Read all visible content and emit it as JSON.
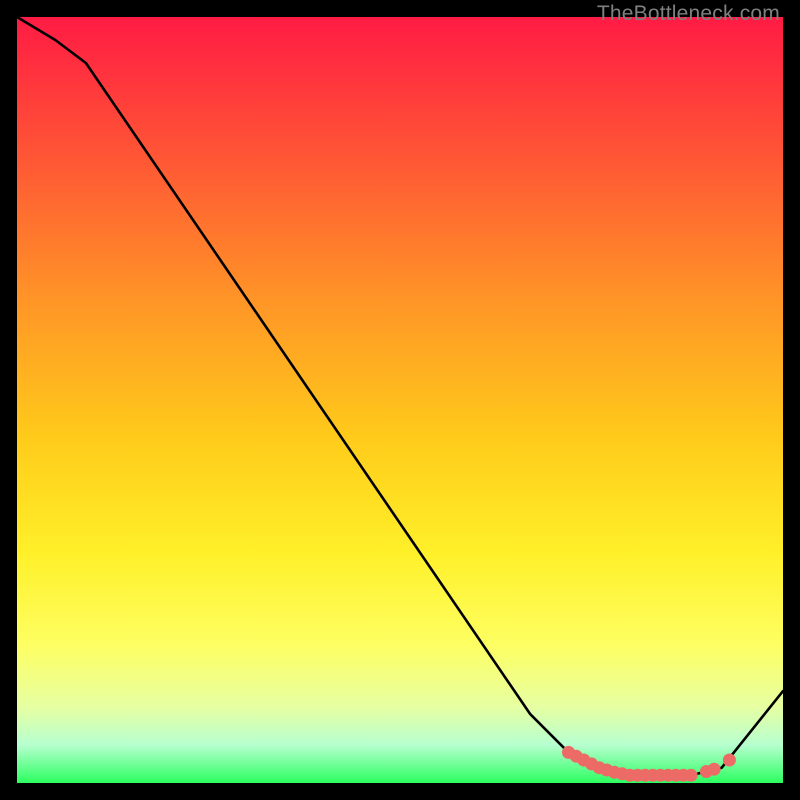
{
  "attribution": "TheBottleneck.com",
  "colors": {
    "black": "#000000",
    "grey": "#7f7f7f",
    "line": "#000000",
    "marker": "#ec6b66",
    "grad_top": "#ff1b44",
    "grad_1": "#ff5535",
    "grad_2": "#ff9826",
    "grad_3": "#ffcb1a",
    "grad_4": "#fff029",
    "grad_5": "#fdff62",
    "grad_6": "#e7ffa2",
    "grad_7": "#b7ffcf",
    "grad_bottom": "#2bff60"
  },
  "chart_data": {
    "type": "line",
    "title": "",
    "xlabel": "",
    "ylabel": "",
    "xlim": [
      0,
      100
    ],
    "ylim": [
      0,
      100
    ],
    "series": [
      {
        "name": "curve",
        "x": [
          0,
          5,
          9,
          67,
          72,
          76,
          80,
          84,
          88,
          92,
          100
        ],
        "y": [
          100,
          97,
          94,
          9,
          4,
          2,
          1,
          1,
          1,
          2,
          12
        ]
      }
    ],
    "markers": {
      "name": "highlight",
      "x": [
        72,
        73,
        74,
        75,
        76,
        77,
        78,
        79,
        80,
        81,
        82,
        83,
        84,
        85,
        86,
        87,
        88,
        90,
        91,
        93
      ],
      "y": [
        4,
        3.5,
        3,
        2.5,
        2,
        1.7,
        1.4,
        1.2,
        1,
        1,
        1,
        1,
        1,
        1,
        1,
        1,
        1,
        1.5,
        1.8,
        3
      ]
    }
  }
}
